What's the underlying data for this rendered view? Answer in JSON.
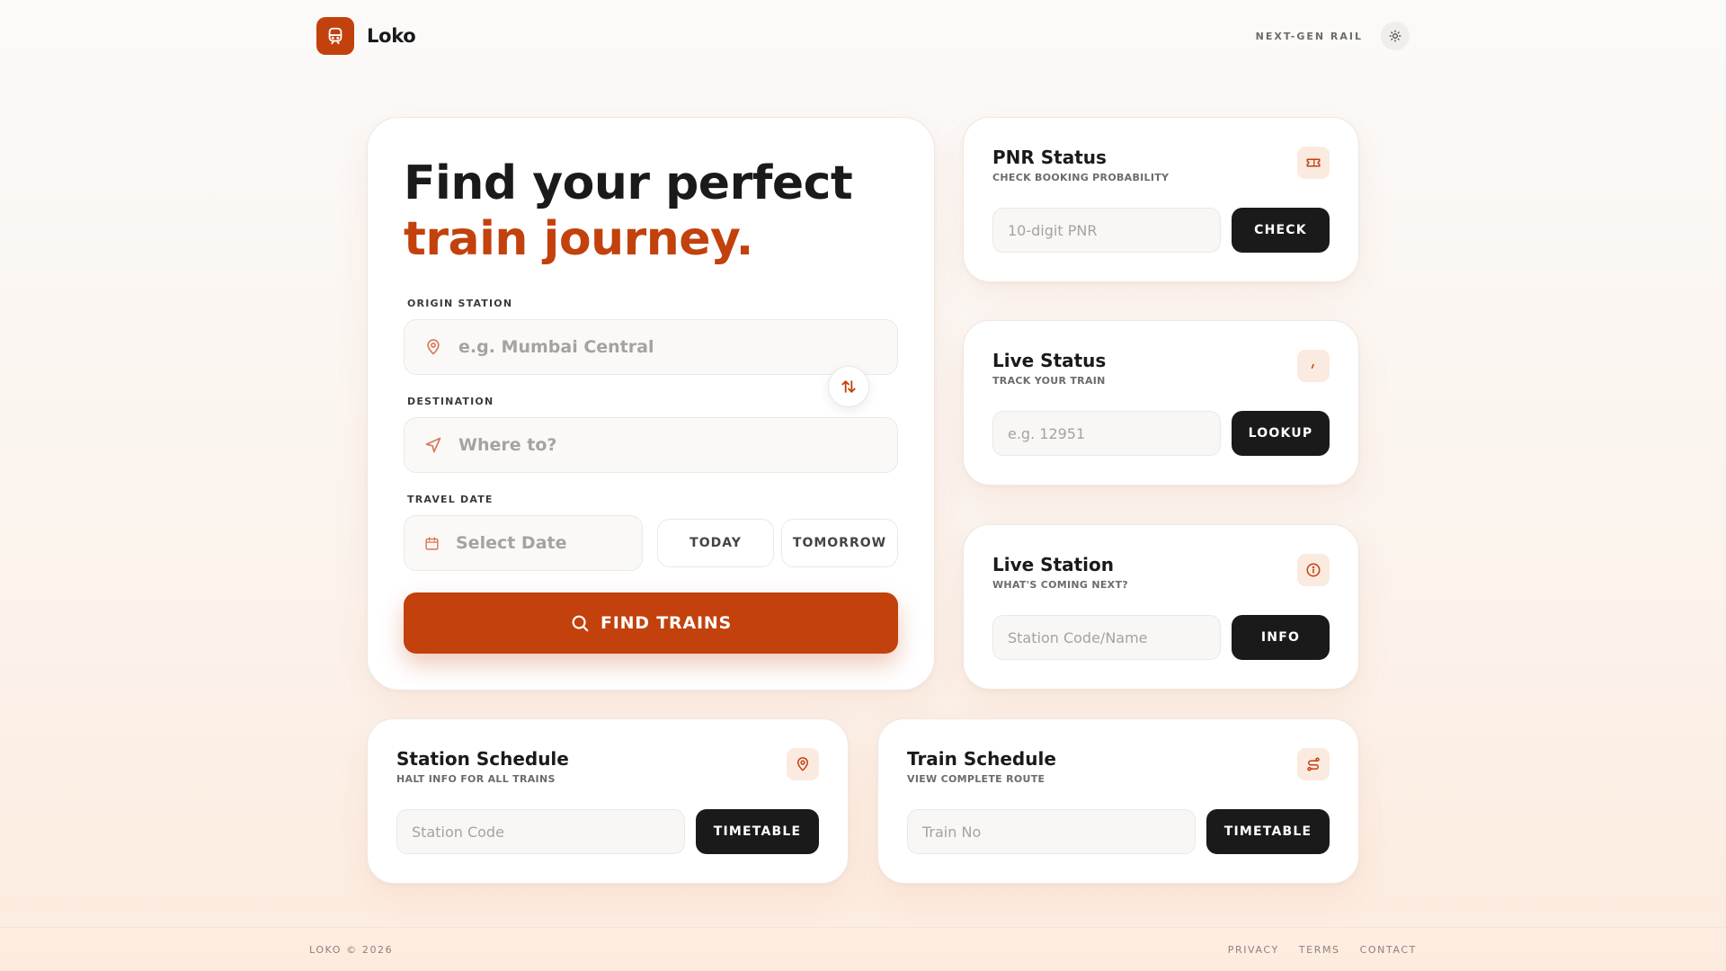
{
  "header": {
    "brand": "Loko",
    "tagline": "NEXT-GEN RAIL"
  },
  "search": {
    "title_line1": "Find your perfect",
    "title_line2": "train journey.",
    "origin_label": "ORIGIN STATION",
    "origin_placeholder": "e.g. Mumbai Central",
    "destination_label": "DESTINATION",
    "destination_placeholder": "Where to?",
    "date_label": "TRAVEL DATE",
    "date_placeholder": "Select Date",
    "today_label": "TODAY",
    "tomorrow_label": "TOMORROW",
    "find_label": "FIND TRAINS"
  },
  "tools": {
    "pnr": {
      "title": "PNR Status",
      "subtitle": "CHECK BOOKING PROBABILITY",
      "placeholder": "10-digit PNR",
      "button": "CHECK",
      "icon": "ticket-icon"
    },
    "live_status": {
      "title": "Live Status",
      "subtitle": "TRACK YOUR TRAIN",
      "placeholder": "e.g. 12951",
      "button": "LOOKUP",
      "icon": "pulse-icon"
    },
    "live_station": {
      "title": "Live Station",
      "subtitle": "WHAT'S COMING NEXT?",
      "placeholder": "Station Code/Name",
      "button": "INFO",
      "icon": "info-icon"
    },
    "station_schedule": {
      "title": "Station Schedule",
      "subtitle": "HALT INFO FOR ALL TRAINS",
      "placeholder": "Station Code",
      "button": "TIMETABLE",
      "icon": "map-pin-icon"
    },
    "train_schedule": {
      "title": "Train Schedule",
      "subtitle": "VIEW COMPLETE ROUTE",
      "placeholder": "Train No",
      "button": "TIMETABLE",
      "icon": "route-icon"
    }
  },
  "footer": {
    "copyright": "LOKO © 2026",
    "links": [
      "PRIVACY",
      "TERMS",
      "CONTACT"
    ]
  },
  "colors": {
    "accent": "#c2410c",
    "dark_button": "#1a1a1a",
    "icon_bg": "#fbeae0"
  }
}
